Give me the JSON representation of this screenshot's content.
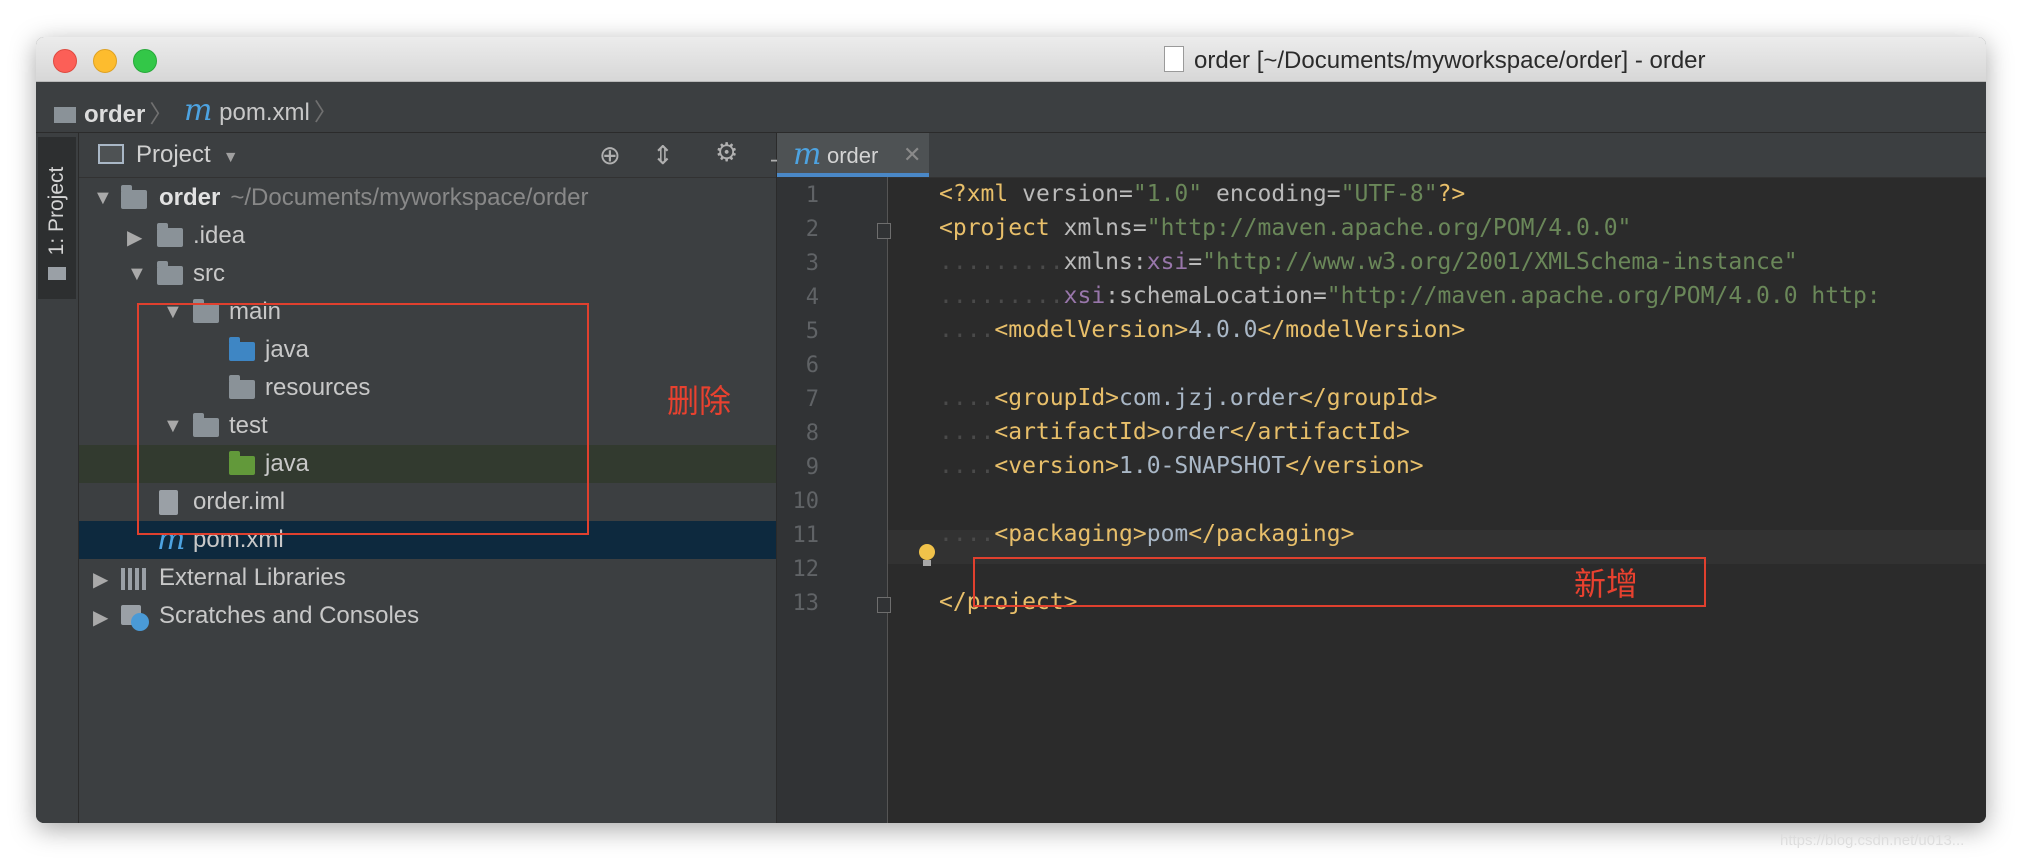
{
  "window": {
    "title": "order [~/Documents/myworkspace/order] - order"
  },
  "breadcrumb": {
    "project": "order",
    "file": "pom.xml"
  },
  "sidestrip": {
    "tab_label": "1: Project"
  },
  "project_panel": {
    "title": "Project",
    "tree": [
      {
        "label": "order",
        "path": "~/Documents/myworkspace/order"
      },
      {
        "label": ".idea"
      },
      {
        "label": "src"
      },
      {
        "label": "main"
      },
      {
        "label": "java"
      },
      {
        "label": "resources"
      },
      {
        "label": "test"
      },
      {
        "label": "java"
      },
      {
        "label": "order.iml"
      },
      {
        "label": "pom.xml"
      },
      {
        "label": "External Libraries"
      },
      {
        "label": "Scratches and Consoles"
      }
    ]
  },
  "annotations": {
    "delete": "删除",
    "add": "新增"
  },
  "editor": {
    "tab_label": "order",
    "line_numbers": [
      "1",
      "2",
      "3",
      "4",
      "5",
      "6",
      "7",
      "8",
      "9",
      "10",
      "11",
      "12",
      "13"
    ],
    "code": {
      "l1": {
        "open": "<?xml",
        "attr1": " version",
        "eq1": "=",
        "val1": "\"1.0\"",
        "attr2": " encoding",
        "eq2": "=",
        "val2": "\"UTF-8\"",
        "close": "?>"
      },
      "l2": {
        "open": "<project",
        "attr": " xmlns",
        "eq": "=",
        "val": "\"http://maven.apache.org/POM/4.0.0\""
      },
      "l3": {
        "attr": "xmlns:",
        "ns": "xsi",
        "eq": "=",
        "val": "\"http://www.w3.org/2001/XMLSchema-instance\""
      },
      "l4": {
        "ns": "xsi",
        "attr": ":schemaLocation",
        "eq": "=",
        "val": "\"http://maven.apache.org/POM/4.0.0 http:"
      },
      "l5": {
        "open": "<modelVersion>",
        "text": "4.0.0",
        "close": "</modelVersion>"
      },
      "l7": {
        "open": "<groupId>",
        "text": "com.jzj.order",
        "close": "</groupId>"
      },
      "l8": {
        "open": "<artifactId>",
        "text": "order",
        "close": "</artifactId>"
      },
      "l9": {
        "open": "<version>",
        "text": "1.0-SNAPSHOT",
        "close": "</version>"
      },
      "l11": {
        "open": "<packaging>",
        "text": "pom",
        "close": "</packaging>"
      },
      "l13": {
        "close": "</project>"
      }
    }
  },
  "watermark": "https://blog.csdn.net/u013...",
  "colors": {
    "selection": "#0d293e",
    "annotation_red": "#e0402e",
    "xml_tag": "#e8bf6a",
    "xml_value": "#6a8759",
    "tab_underline": "#4a88c7"
  }
}
